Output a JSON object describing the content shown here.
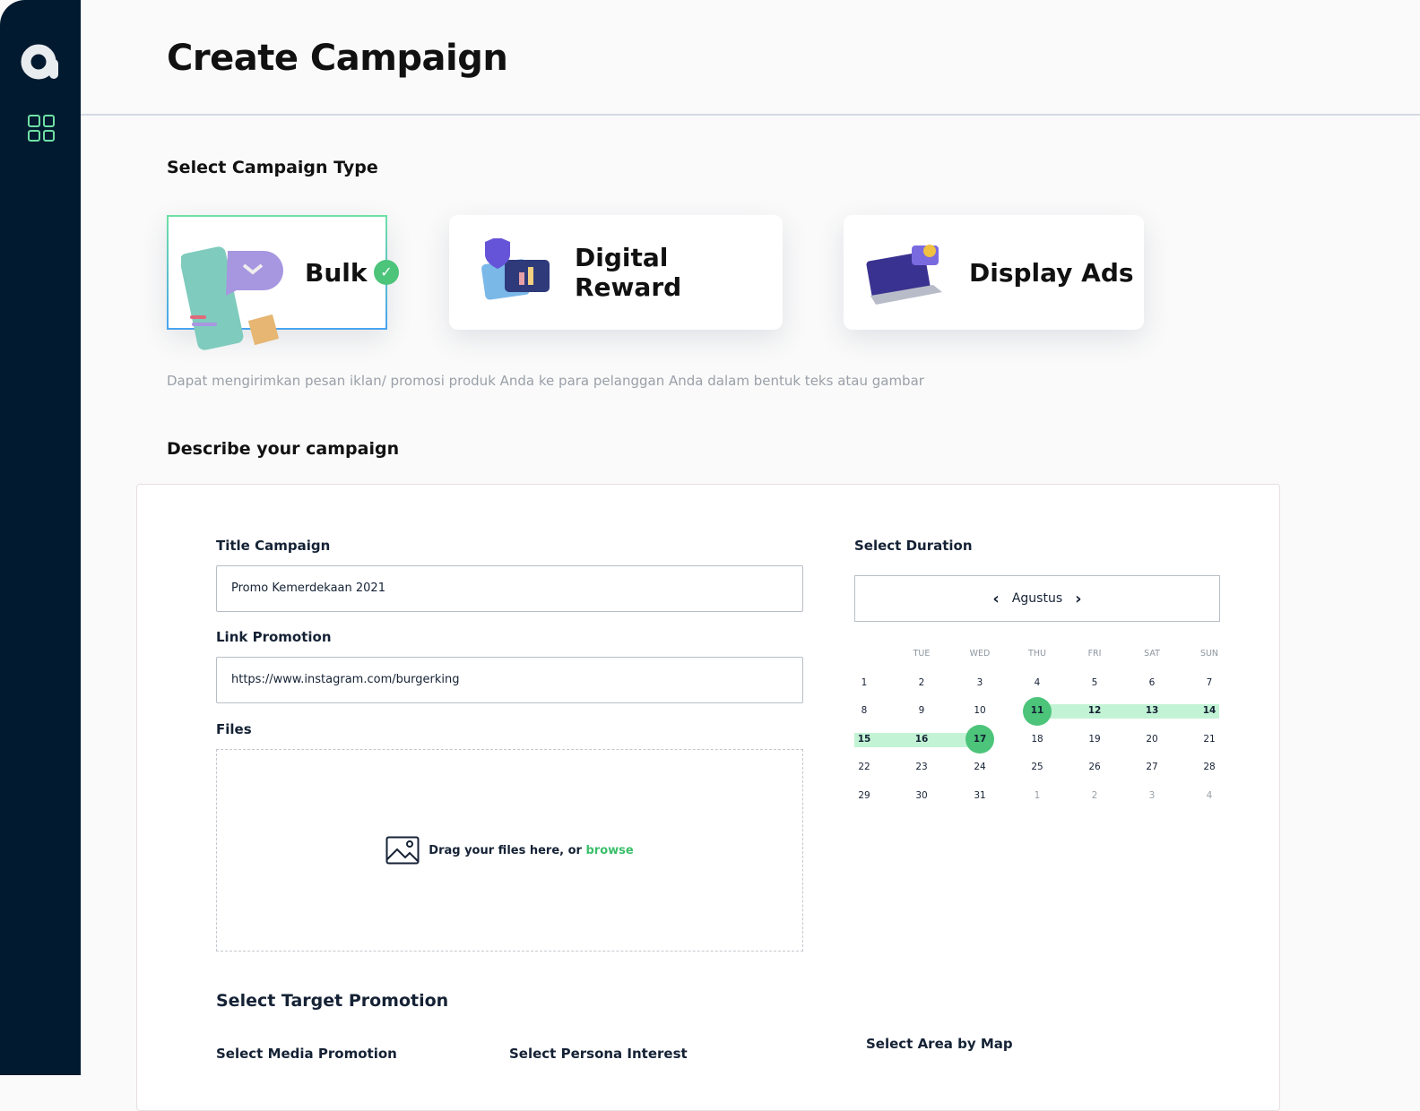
{
  "page_title": "Create Campaign",
  "campaign_type": {
    "heading": "Select Campaign Type",
    "options": [
      {
        "label": "Bulk",
        "selected": true
      },
      {
        "label": "Digital Reward",
        "selected": false
      },
      {
        "label": "Display Ads",
        "selected": false
      }
    ],
    "description": "Dapat mengirimkan pesan iklan/ promosi produk Anda ke para pelanggan Anda dalam bentuk teks atau gambar"
  },
  "describe": {
    "heading": "Describe your campaign",
    "title_label": "Title Campaign",
    "title_value": "Promo Kemerdekaan 2021",
    "link_label": "Link Promotion",
    "link_value": "https://www.instagram.com/burgerking",
    "files_label": "Files",
    "drop_text": "Drag your files here, or ",
    "browse": "browse"
  },
  "duration": {
    "label": "Select Duration",
    "month": "Agustus",
    "weekdays": [
      "",
      "TUE",
      "WED",
      "THU",
      "FRI",
      "SAT",
      "SUN"
    ],
    "weeks": [
      [
        "1",
        "2",
        "3",
        "4",
        "5",
        "6",
        "7"
      ],
      [
        "8",
        "9",
        "10",
        "11",
        "12",
        "13",
        "14"
      ],
      [
        "15",
        "16",
        "17",
        "18",
        "19",
        "20",
        "21"
      ],
      [
        "22",
        "23",
        "24",
        "25",
        "26",
        "27",
        "28"
      ],
      [
        "29",
        "30",
        "31",
        "1",
        "2",
        "3",
        "4"
      ]
    ],
    "range_start": "11",
    "range_end": "17"
  },
  "target": {
    "heading": "Select Target Promotion",
    "media_label": "Select Media Promotion",
    "persona_label": "Select Persona Interest",
    "area_label": "Select Area by Map"
  },
  "colors": {
    "sidebar": "#021a30",
    "accent": "#4cc47a",
    "range": "#c3f3d5"
  }
}
